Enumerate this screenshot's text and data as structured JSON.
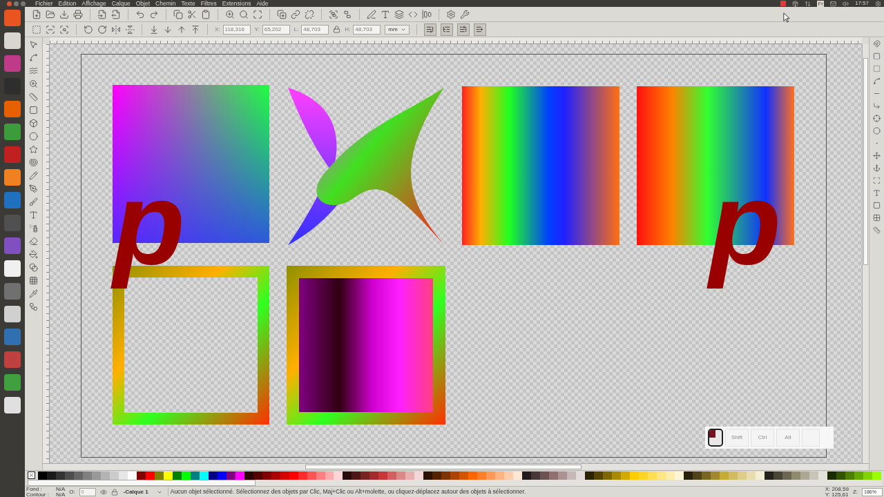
{
  "menu": [
    "Fichier",
    "Edition",
    "Affichage",
    "Calque",
    "Objet",
    "Chemin",
    "Texte",
    "Filtres",
    "Extensions",
    "Aide"
  ],
  "tray": {
    "language": "Fr",
    "clock": "17:57"
  },
  "fields": [
    {
      "label": "X:",
      "value": "118,316"
    },
    {
      "label": "Y:",
      "value": "65,202"
    },
    {
      "label": "L:",
      "value": "48,703"
    },
    {
      "label": "H:",
      "value": "48,703"
    }
  ],
  "unit": "mm",
  "canvas_letters": [
    "p",
    "p"
  ],
  "key_overlay": {
    "mouse_left_pressed": true,
    "keys": [
      {
        "label": "Shift",
        "pressed": false
      },
      {
        "label": "Ctrl",
        "pressed": false
      },
      {
        "label": "Alt",
        "pressed": false
      }
    ]
  },
  "palette": [
    {
      "color": "#000000"
    },
    {
      "color": "#1a1a1a"
    },
    {
      "color": "#333333"
    },
    {
      "color": "#4d4d4d"
    },
    {
      "color": "#666666"
    },
    {
      "color": "#808080"
    },
    {
      "color": "#999999"
    },
    {
      "color": "#b3b3b3"
    },
    {
      "color": "#cccccc"
    },
    {
      "color": "#e6e6e6"
    },
    {
      "color": "#ffffff"
    },
    {
      "color": "#800000"
    },
    {
      "color": "#ff0000"
    },
    {
      "color": "#808000"
    },
    {
      "color": "#ffff00"
    },
    {
      "color": "#008000"
    },
    {
      "color": "#00ff00"
    },
    {
      "color": "#008080"
    },
    {
      "color": "#00ffff"
    },
    {
      "color": "#000080"
    },
    {
      "color": "#0000ff"
    },
    {
      "color": "#800080"
    },
    {
      "color": "#ff00ff"
    },
    {
      "color": "#2b0000"
    },
    {
      "color": "#550000"
    },
    {
      "color": "#800000"
    },
    {
      "color": "#aa0000"
    },
    {
      "color": "#d40000"
    },
    {
      "color": "#ff0000"
    },
    {
      "color": "#ff2a2a"
    },
    {
      "color": "#ff5555"
    },
    {
      "color": "#ff8080"
    },
    {
      "color": "#ffaaaa"
    },
    {
      "color": "#ffd5d5"
    },
    {
      "color": "#280b0b"
    },
    {
      "color": "#501616"
    },
    {
      "color": "#782121"
    },
    {
      "color": "#a02c2c"
    },
    {
      "color": "#c83737"
    },
    {
      "color": "#d35f5f"
    },
    {
      "color": "#de8787"
    },
    {
      "color": "#e9afaf"
    },
    {
      "color": "#f4d7d7"
    },
    {
      "color": "#2b1100"
    },
    {
      "color": "#552200"
    },
    {
      "color": "#803300"
    },
    {
      "color": "#aa4400"
    },
    {
      "color": "#d45500"
    },
    {
      "color": "#ff6600"
    },
    {
      "color": "#ff7f2a"
    },
    {
      "color": "#ff9955"
    },
    {
      "color": "#ffb380"
    },
    {
      "color": "#ffccaa"
    },
    {
      "color": "#ffe6d5"
    },
    {
      "color": "#241c1c"
    },
    {
      "color": "#483737"
    },
    {
      "color": "#6c5353"
    },
    {
      "color": "#916f6f"
    },
    {
      "color": "#ac9393"
    },
    {
      "color": "#c8b7b7"
    },
    {
      "color": "#e3dbdb"
    },
    {
      "color": "#2b2200"
    },
    {
      "color": "#554400"
    },
    {
      "color": "#806600"
    },
    {
      "color": "#aa8800"
    },
    {
      "color": "#d4aa00"
    },
    {
      "color": "#ffcc00"
    },
    {
      "color": "#ffd42a"
    },
    {
      "color": "#ffdd55"
    },
    {
      "color": "#ffe680"
    },
    {
      "color": "#ffeeaa"
    },
    {
      "color": "#fff6d5"
    },
    {
      "color": "#28220b"
    },
    {
      "color": "#504416"
    },
    {
      "color": "#786721"
    },
    {
      "color": "#a0892c"
    },
    {
      "color": "#c8ab37"
    },
    {
      "color": "#d3bc5f"
    },
    {
      "color": "#decd87"
    },
    {
      "color": "#e9ddaf"
    },
    {
      "color": "#f4eed7"
    },
    {
      "color": "#24221c"
    },
    {
      "color": "#484537"
    },
    {
      "color": "#6c6753"
    },
    {
      "color": "#918a6f"
    },
    {
      "color": "#aca793"
    },
    {
      "color": "#c8c4b7"
    },
    {
      "color": "#e3e2db"
    },
    {
      "color": "#1a2b00"
    },
    {
      "color": "#335500"
    },
    {
      "color": "#4d8000"
    },
    {
      "color": "#66aa00"
    },
    {
      "color": "#80d400"
    },
    {
      "color": "#99ff00"
    }
  ],
  "status": {
    "fill_label": "Fond :",
    "fill_value": "N/A",
    "stroke_label": "Contour :",
    "stroke_value": "N/A",
    "opacity_label": "O:",
    "opacity_value": "0",
    "layer": "-Calque 1",
    "message": "Aucun objet sélectionné. Sélectionnez des objets par Clic, Maj+Clic ou Alt+molette, ou cliquez-déplacez autour des objets à sélectionner.",
    "cursor_x": "X: 208,59",
    "cursor_y": "Y: 125,61",
    "zoom_label": "Z:",
    "zoom": "186%"
  }
}
